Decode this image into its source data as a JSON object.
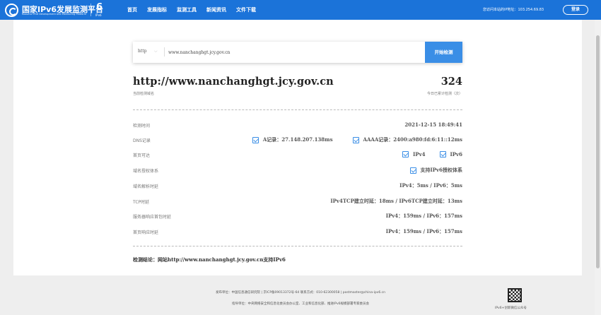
{
  "header": {
    "logo_title": "国家IPv6发展监测平台",
    "logo_subtitle": "National IPv6 Development and Monitoring Platform",
    "badge_number": "6",
    "badge_text": "IPv6",
    "nav": [
      "首页",
      "发展指标",
      "监测工具",
      "新闻资讯",
      "文件下载"
    ],
    "visit_ip": "您访问本站的IP地址：103.254.69.83",
    "login": "登录"
  },
  "search": {
    "protocol": "http",
    "url_value": "www.nanchanghgt.jcy.gov.cn",
    "button": "开始检测"
  },
  "result": {
    "domain": "http://www.nanchanghgt.jcy.gov.cn",
    "domain_label": "当前检测域名",
    "count": "324",
    "count_label": "今日已累计检测（次）"
  },
  "rows": {
    "time": {
      "label": "检测时间",
      "value": "2021-12-15 18:49:41"
    },
    "dns": {
      "label": "DNS记录",
      "a": "A记录：27.148.207.138ms",
      "aaaa": "AAAA记录：2400:a980:fd:6:11::12ms"
    },
    "homepage": {
      "label": "首页可达",
      "ipv4": "IPv4",
      "ipv6": "IPv6"
    },
    "authority": {
      "label": "域名授权体系",
      "value": "支持IPv6授权体系"
    },
    "resolve": {
      "label": "域名解析时延",
      "value": "IPv4：5ms / IPv6：5ms"
    },
    "tcp": {
      "label": "TCP时延",
      "value": "IPv4TCP建立时延：18ms / IPv6TCP建立时延：13ms"
    },
    "first_packet": {
      "label": "服务器响应首包时延",
      "value": "IPv4：159ms / IPv6：157ms"
    },
    "first_page": {
      "label": "首页响应时延",
      "value": "IPv4：159ms / IPv6：157ms"
    }
  },
  "conclusion": "检测结论：网站http://www.nanchanghgt.jcy.gov.cn支持IPv6",
  "footer": {
    "line1": "发布单位：中国信息通信研究院 | 京ICP备09013372号-64 联系方式：010-62300058 | postmaster@china-ipv6.cn",
    "line2": "指导单位：中央网络安全和信息化委员会办公室、工业和信息化部、推进IPv6规模部署专家委员会",
    "qr_label": "IPv6+创新微信公众号"
  }
}
